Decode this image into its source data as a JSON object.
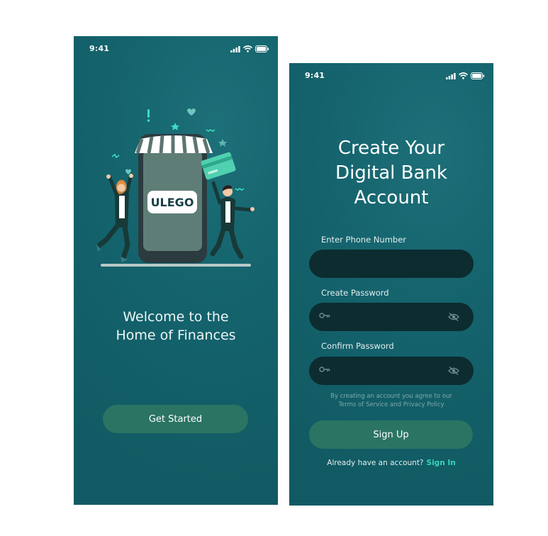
{
  "colors": {
    "background": "#14636d",
    "button": "#2b7463",
    "input": "#0c2c30",
    "link": "#37d6bd"
  },
  "welcome_screen": {
    "status_time": "9:41",
    "logo_text": "ULEGO",
    "welcome_line1": "Welcome to the",
    "welcome_line2": "Home of Finances",
    "get_started_label": "Get Started"
  },
  "signup_screen": {
    "status_time": "9:41",
    "title": "Create Your\nDigital Bank\nAccount",
    "phone_label": "Enter Phone Number",
    "password_label": "Create Password",
    "confirm_label": "Confirm Password",
    "terms_line1": "By creating an account you agree to our",
    "terms_line2": "Terms of Service and Privacy Policy",
    "sign_up_label": "Sign Up",
    "have_account_text": "Already have an account?",
    "sign_in_link": "Sign In"
  },
  "icons": [
    "signal-icon",
    "wifi-icon",
    "battery-icon",
    "key-icon",
    "eye-off-icon"
  ]
}
